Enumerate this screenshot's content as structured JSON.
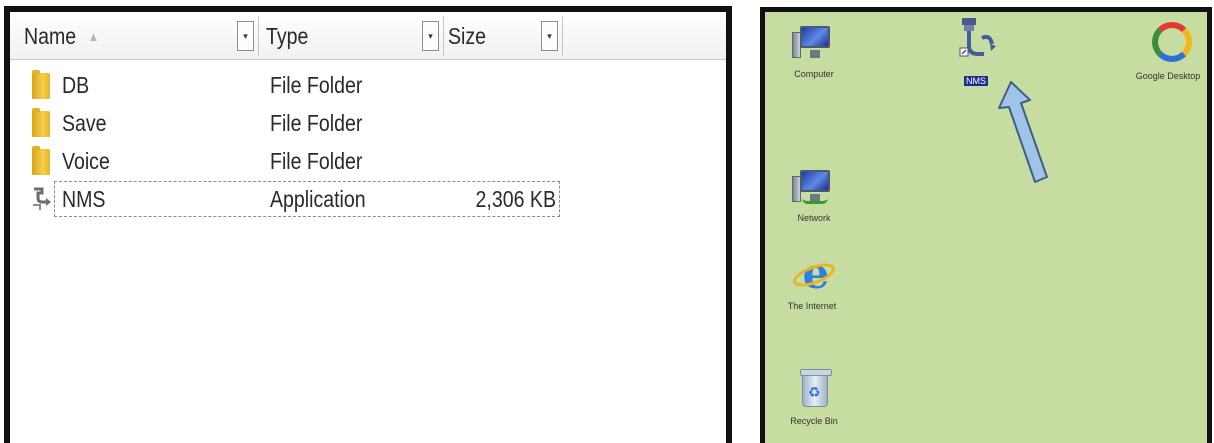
{
  "explorer": {
    "columns": [
      {
        "label": "Name",
        "sort_indicator": "▲"
      },
      {
        "label": "Type"
      },
      {
        "label": "Size"
      }
    ],
    "dropdown_glyph": "▾",
    "rows": [
      {
        "name": "DB",
        "type": "File Folder",
        "size": "",
        "icon": "folder-icon"
      },
      {
        "name": "Save",
        "type": "File Folder",
        "size": "",
        "icon": "folder-icon"
      },
      {
        "name": "Voice",
        "type": "File Folder",
        "size": "",
        "icon": "folder-icon"
      },
      {
        "name": "NMS",
        "type": "Application",
        "size": "2,306 KB",
        "icon": "nms-app-icon",
        "selected": true
      }
    ]
  },
  "desktop": {
    "background": "#c6dca0",
    "icons": [
      {
        "label": "Computer",
        "icon": "computer-icon"
      },
      {
        "label": "Network",
        "icon": "network-icon"
      },
      {
        "label": "The Internet",
        "icon": "internet-explorer-icon"
      },
      {
        "label": "Recycle Bin",
        "icon": "recycle-bin-icon"
      },
      {
        "label": "NMS",
        "icon": "nms-app-icon",
        "highlighted": true
      },
      {
        "label": "Google Desktop",
        "icon": "google-desktop-icon"
      }
    ],
    "pointer_arrow_color": "#9fc4e8"
  }
}
